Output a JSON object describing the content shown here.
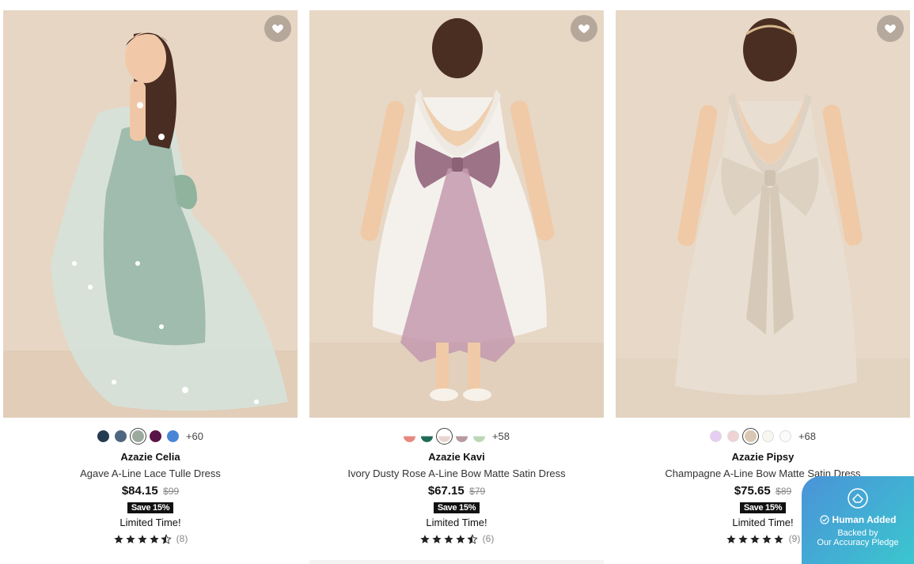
{
  "products": [
    {
      "brand": "Azazie Celia",
      "name": "Agave A-Line Lace Tulle Dress",
      "price": "$84.15",
      "original_price": "$99",
      "save_badge": "Save 15%",
      "promo": "Limited Time!",
      "rating_count": "(8)",
      "rating": 4.5,
      "more_colors": "+60",
      "swatches": [
        "#233a52",
        "#4e6680",
        "#9aab9e",
        "#5a1548",
        "#4a86d6"
      ],
      "selected_swatch": 2,
      "dress_color": "#cfe0d8",
      "bow_color": "#8fb39c"
    },
    {
      "brand": "Azazie Kavi",
      "name": "Ivory Dusty Rose A-Line Bow Matte Satin Dress",
      "price": "$67.15",
      "original_price": "$79",
      "save_badge": "Save 15%",
      "promo": "Limited Time!",
      "rating_count": "(6)",
      "rating": 4.5,
      "more_colors": "+58",
      "swatches": [
        "#e8877e",
        "#1f6b57",
        "#e9d3cf",
        "#b89aa2",
        "#bcd7b8"
      ],
      "selected_swatch": 2,
      "dress_color": "#f4f1ec",
      "bow_color": "#9d7388"
    },
    {
      "brand": "Azazie Pipsy",
      "name": "Champagne A-Line Bow Matte Satin Dress",
      "price": "$75.65",
      "original_price": "$89",
      "save_badge": "Save 15%",
      "promo": "Limited Time!",
      "rating_count": "(9)",
      "rating": 5,
      "more_colors": "+68",
      "swatches": [
        "#e6cdf3",
        "#efd2d4",
        "#d9c7b4",
        "#f8f6f0",
        "#fbfbfb"
      ],
      "selected_swatch": 2,
      "dress_color": "#e8dfd2",
      "bow_color": "#ddd2c2"
    }
  ],
  "pledge": {
    "title": "Human Added",
    "line1": "Backed by",
    "line2": "Our Accuracy Pledge"
  },
  "colors": {
    "photo_bg": "#e6d5c2",
    "floor": "#e4d2bf",
    "text": "#111111"
  },
  "icons": {
    "favorite": "heart-icon",
    "rating": "star-icon",
    "pledge": "shield-icon",
    "check": "check-circle-icon"
  }
}
